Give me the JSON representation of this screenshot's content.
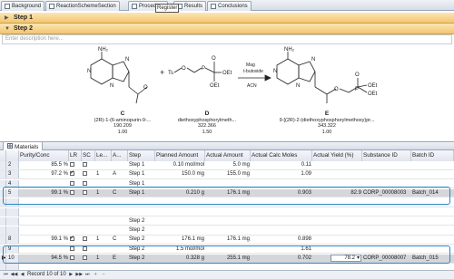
{
  "tabs": [
    {
      "label": "Background",
      "icon": "document-icon"
    },
    {
      "label": "ReactionSchemeSection",
      "icon": "reaction-icon"
    },
    {
      "label": "Procedure",
      "icon": "procedure-icon"
    },
    {
      "label": "Results",
      "icon": "results-icon"
    },
    {
      "label": "Conclusions",
      "icon": "conclusions-icon"
    }
  ],
  "tooltip": "Register",
  "steps": {
    "step1": "Step 1",
    "step2": "Step 2"
  },
  "description_placeholder": "Enter description here...",
  "scheme": {
    "plus": "+",
    "reagents_above": "Mag\nt-butoxide",
    "reagents_below": "ACN",
    "compounds": [
      {
        "letter": "C",
        "name": "(2R)-1-(6-aminopurin-9-...",
        "mw": "190.209",
        "mw2": "1.00"
      },
      {
        "letter": "D",
        "name": "diethoxyphosphorylmeth...",
        "mw": "322.366",
        "mw2": "1.50"
      },
      {
        "letter": "E",
        "name": "9-[(2R)-2-(diethoxyphosphorylmethoxy)pr...",
        "mw": "343.322",
        "mw2": "1.00"
      }
    ],
    "atoms": {
      "N": "N",
      "O": "O",
      "OEt": "OEt",
      "P": "P",
      "Ts": "Ts",
      "NH2": "NH₂"
    }
  },
  "materials": {
    "tab_label": "Materials",
    "columns": [
      "",
      "",
      "Purity/Conc",
      "LR",
      "SC",
      "Le...",
      "A...",
      "Step",
      "Planned Amount",
      "Actual Amount",
      "Actual Calc Moles",
      "Actual Yield (%)",
      "Substance ID",
      "Batch ID"
    ],
    "rows": [
      {
        "n": "2",
        "purity": "85.5 %",
        "lr": false,
        "sc": false,
        "le": "",
        "a": "",
        "step": "Step 1",
        "planned": "0.10 mol/mol",
        "actual": "5.0 mg",
        "moles": "0.11",
        "yield": "",
        "sid": "",
        "bid": ""
      },
      {
        "n": "3",
        "purity": "97.2 %",
        "lr": true,
        "sc": false,
        "le": "1",
        "a": "A",
        "step": "Step 1",
        "planned": "150.0 mg",
        "actual": "155.0 mg",
        "moles": "1.09",
        "yield": "",
        "sid": "",
        "bid": ""
      },
      {
        "n": "4",
        "purity": "",
        "lr": false,
        "sc": false,
        "le": "",
        "a": "",
        "step": "Step 1",
        "planned": "",
        "actual": "",
        "moles": "",
        "yield": "",
        "sid": "",
        "bid": ""
      },
      {
        "n": "5",
        "purity": "99.1 %",
        "lr": false,
        "sc": false,
        "le": "1",
        "a": "C",
        "step": "Step 1",
        "planned": "0.210 g",
        "actual": "176.1 mg",
        "moles": "0.903",
        "yield": "82.9",
        "sid": "CORP_00008003",
        "bid": "Batch_014"
      },
      {
        "n": "",
        "purity": "",
        "lr": false,
        "sc": false,
        "le": "",
        "a": "",
        "step": "",
        "planned": "",
        "actual": "",
        "moles": "",
        "yield": "",
        "sid": "",
        "bid": ""
      },
      {
        "n": "",
        "purity": "",
        "lr": false,
        "sc": false,
        "le": "",
        "a": "",
        "step": "",
        "planned": "",
        "actual": "",
        "moles": "",
        "yield": "",
        "sid": "",
        "bid": ""
      },
      {
        "n": "",
        "purity": "",
        "lr": false,
        "sc": false,
        "le": "",
        "a": "",
        "step": "Step 2",
        "planned": "",
        "actual": "",
        "moles": "",
        "yield": "",
        "sid": "",
        "bid": ""
      },
      {
        "n": "",
        "purity": "",
        "lr": false,
        "sc": false,
        "le": "",
        "a": "",
        "step": "Step 2",
        "planned": "",
        "actual": "",
        "moles": "",
        "yield": "",
        "sid": "",
        "bid": ""
      },
      {
        "n": "8",
        "purity": "99.1 %",
        "lr": true,
        "sc": false,
        "le": "1",
        "a": "C",
        "step": "Step 2",
        "planned": "176.1 mg",
        "actual": "176.1 mg",
        "moles": "0.898",
        "yield": "",
        "sid": "",
        "bid": ""
      },
      {
        "n": "9",
        "purity": "",
        "lr": false,
        "sc": false,
        "le": "",
        "a": "",
        "step": "Step 2",
        "planned": "1.5 mol/mol",
        "actual": "",
        "moles": "1.61",
        "yield": "",
        "sid": "",
        "bid": ""
      },
      {
        "n": "10",
        "purity": "94.5 %",
        "lr": false,
        "sc": false,
        "le": "1",
        "a": "E",
        "step": "Step 2",
        "planned": "0.328 g",
        "actual": "255.1 mg",
        "moles": "0.702",
        "yield": "78.2",
        "sid": "CORP_00008007",
        "bid": "Batch_015"
      },
      {
        "n": "",
        "purity": "",
        "lr": false,
        "sc": false,
        "le": "",
        "a": "",
        "step": "",
        "planned": "",
        "actual": "",
        "moles": "",
        "yield": "",
        "sid": "",
        "bid": ""
      }
    ]
  },
  "nav": {
    "record": "Record 10 of 10"
  },
  "colors": {
    "highlight": "#2a86c6",
    "step_bar": "#f3c46d"
  }
}
